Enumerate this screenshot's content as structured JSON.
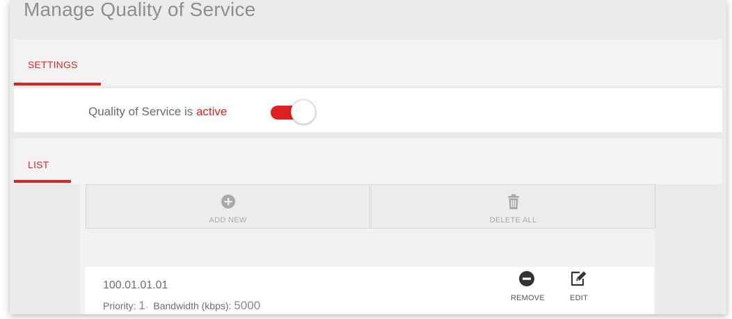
{
  "page": {
    "title": "Manage Quality of Service"
  },
  "settings": {
    "tab_label": "SETTINGS",
    "qos_prefix": "Quality of Service is ",
    "qos_status": "active",
    "toggle_on": true
  },
  "list": {
    "tab_label": "LIST",
    "add_new_label": "ADD NEW",
    "delete_all_label": "DELETE ALL",
    "entries": [
      {
        "ip": "100.01.01.01",
        "priority_label": "Priority:",
        "priority_value": "1",
        "priority_sep": "-",
        "bandwidth_label": "Bandwidth (kbps):",
        "bandwidth_value": "5000",
        "remove_label": "REMOVE",
        "edit_label": "EDIT"
      }
    ]
  },
  "colors": {
    "accent": "#e01f1f",
    "background": "#ebebeb",
    "card": "#ffffff"
  },
  "icons": [
    "plus-circle-icon",
    "trash-icon",
    "minus-circle-icon",
    "edit-icon"
  ]
}
